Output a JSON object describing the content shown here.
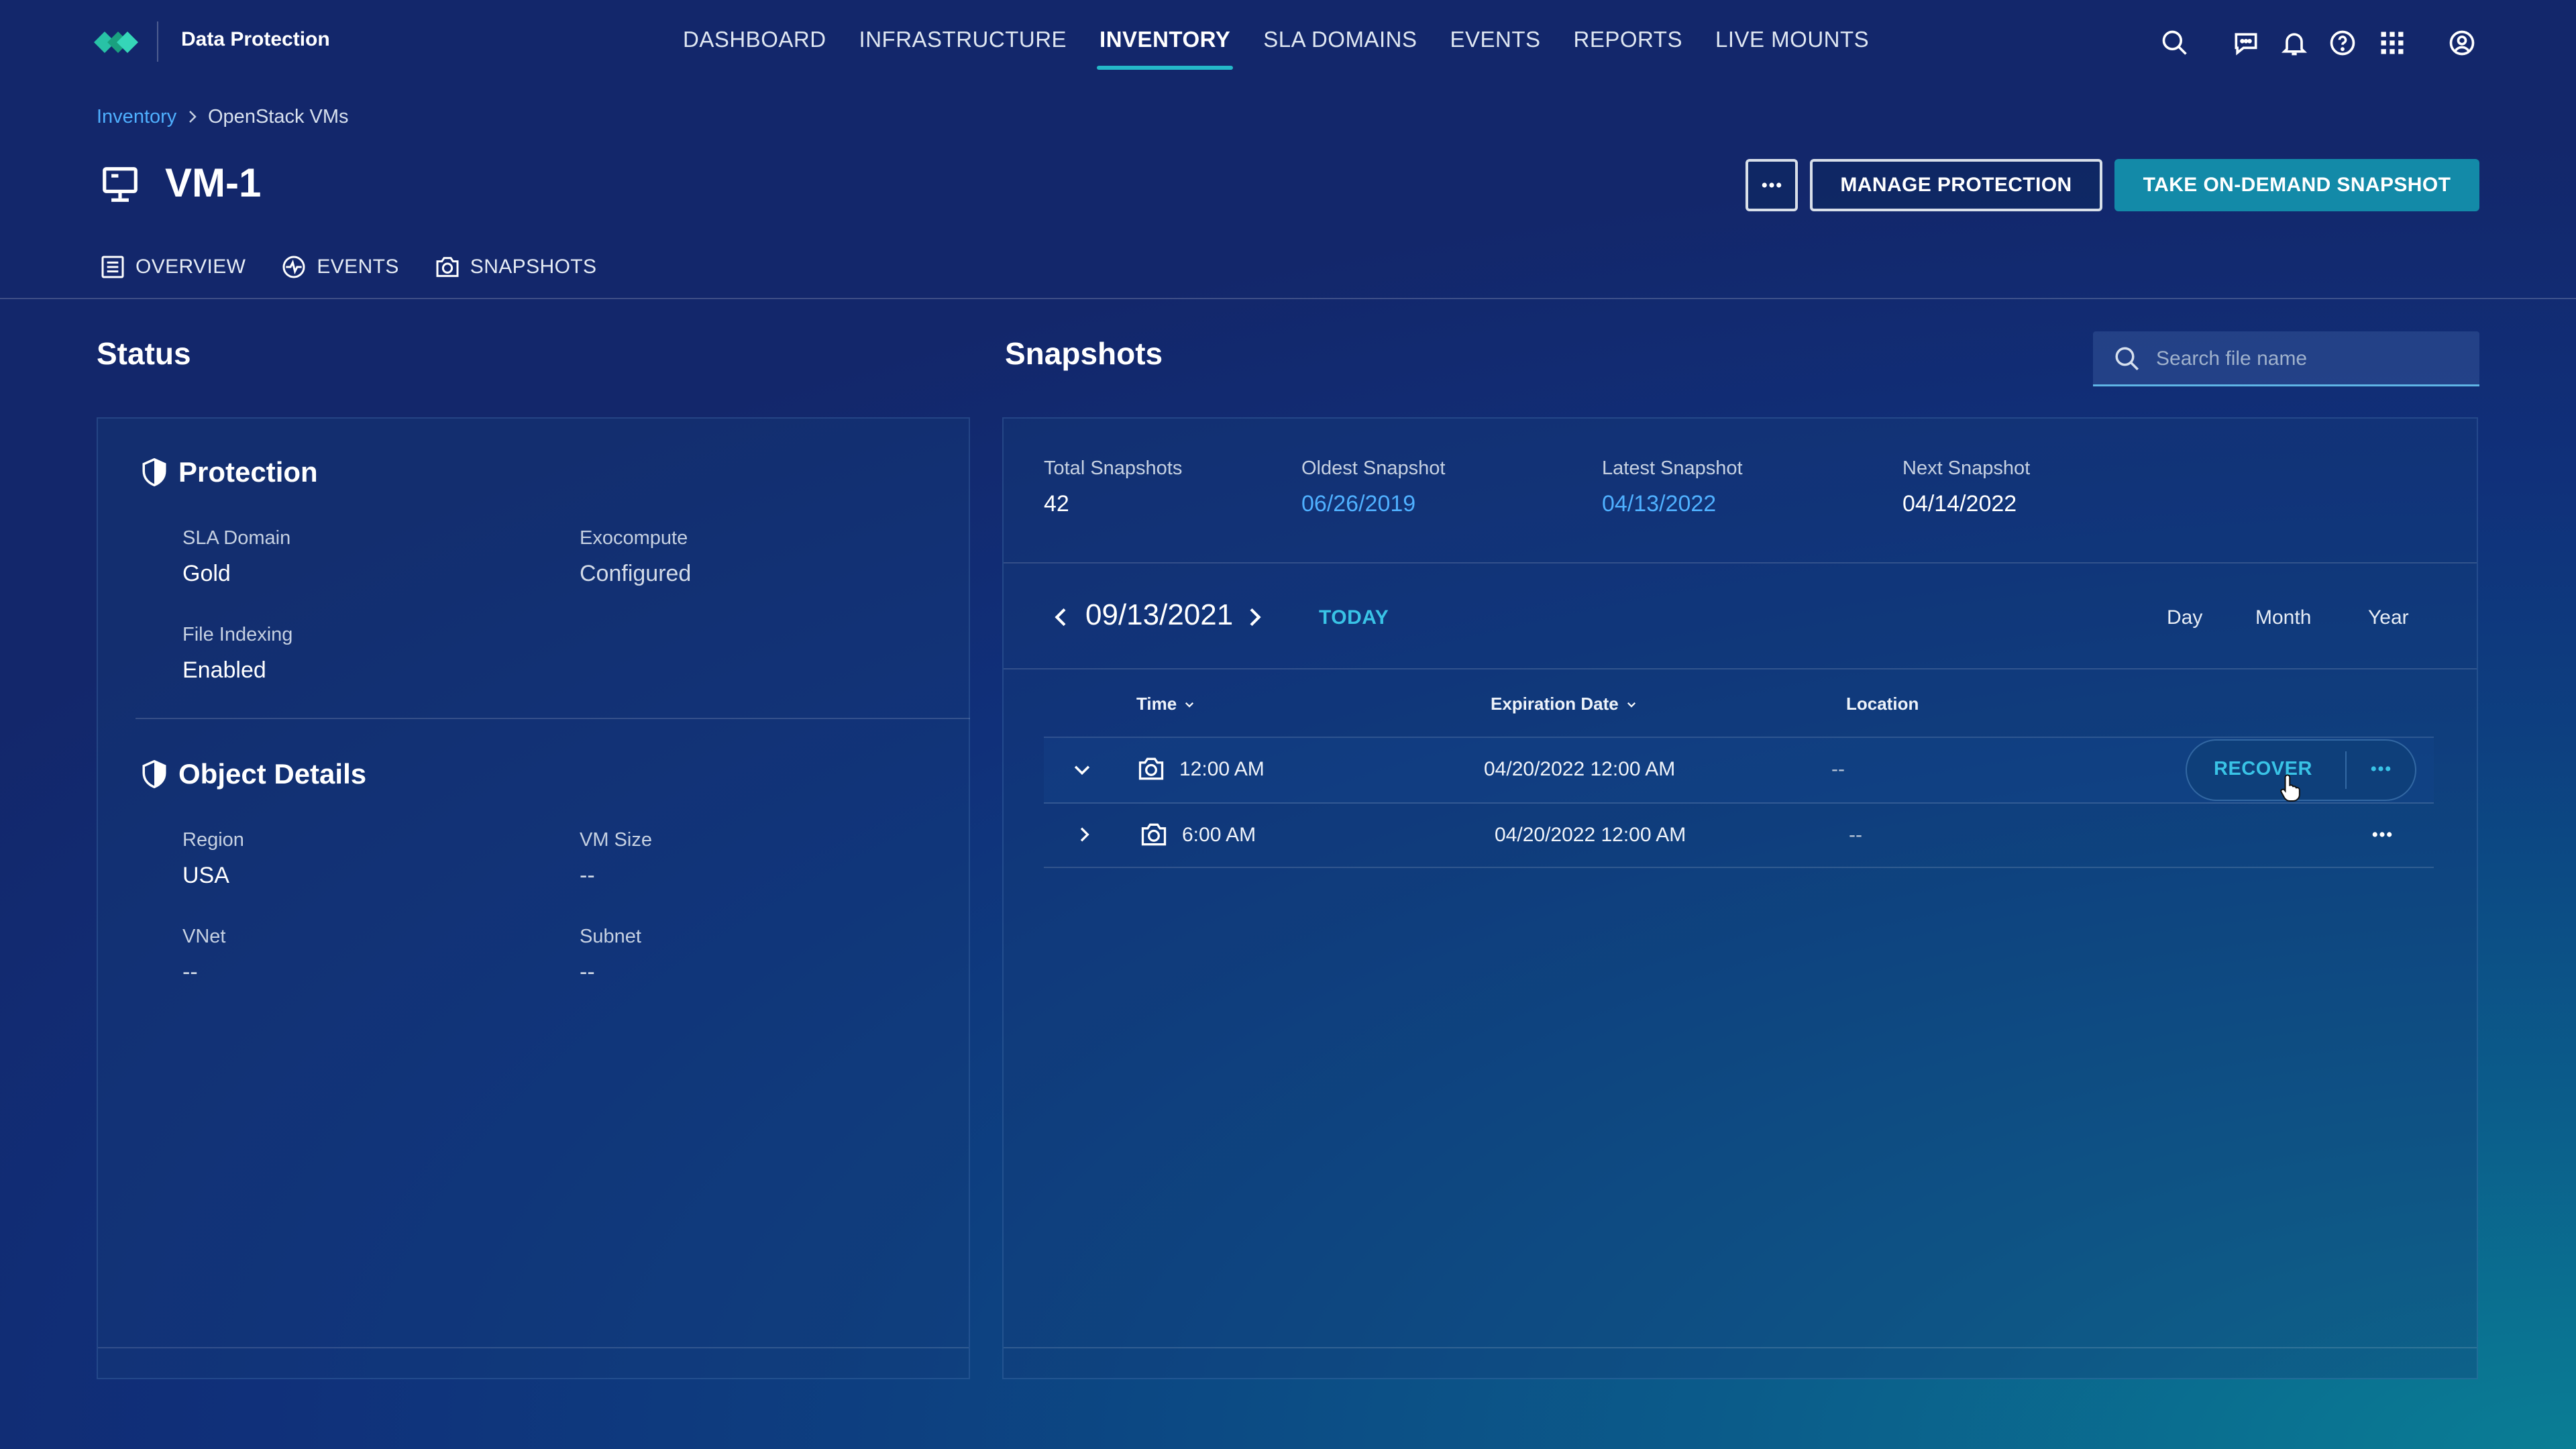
{
  "app": {
    "brand": "Data Protection"
  },
  "nav": {
    "items": [
      {
        "label": "DASHBOARD",
        "active": false
      },
      {
        "label": "INFRASTRUCTURE",
        "active": false
      },
      {
        "label": "INVENTORY",
        "active": true
      },
      {
        "label": "SLA DOMAINS",
        "active": false
      },
      {
        "label": "EVENTS",
        "active": false
      },
      {
        "label": "REPORTS",
        "active": false
      },
      {
        "label": "LIVE MOUNTS",
        "active": false
      }
    ],
    "icons": [
      "search-icon",
      "chat-icon",
      "bell-icon",
      "help-icon",
      "apps-grid-icon",
      "user-account-icon"
    ]
  },
  "breadcrumb": {
    "parent": "Inventory",
    "current": "OpenStack VMs"
  },
  "page": {
    "title": "VM-1",
    "buttons": {
      "more": "more-options",
      "manage": "MANAGE PROTECTION",
      "snapshot": "TAKE ON-DEMAND SNAPSHOT"
    }
  },
  "tabs": [
    {
      "label": "OVERVIEW",
      "icon": "list-icon"
    },
    {
      "label": "EVENTS",
      "icon": "activity-icon"
    },
    {
      "label": "SNAPSHOTS",
      "icon": "camera-icon"
    }
  ],
  "status": {
    "heading": "Status",
    "protection": {
      "heading": "Protection",
      "sla_label": "SLA Domain",
      "sla_value": "Gold",
      "exo_label": "Exocompute",
      "exo_value": "Configured",
      "idx_label": "File Indexing",
      "idx_value": "Enabled"
    },
    "object": {
      "heading": "Object Details",
      "region_label": "Region",
      "region_value": "USA",
      "size_label": "VM Size",
      "size_value": "--",
      "vnet_label": "VNet",
      "vnet_value": "--",
      "subnet_label": "Subnet",
      "subnet_value": "--"
    }
  },
  "snapshots": {
    "heading": "Snapshots",
    "search_placeholder": "Search file name",
    "summary": {
      "total_label": "Total Snapshots",
      "total_value": "42",
      "oldest_label": "Oldest Snapshot",
      "oldest_value": "06/26/2019",
      "latest_label": "Latest Snapshot",
      "latest_value": "04/13/2022",
      "next_label": "Next Snapshot",
      "next_value": "04/14/2022"
    },
    "calendar": {
      "date": "09/13/2021",
      "today": "TODAY",
      "views": [
        "Day",
        "Month",
        "Year"
      ]
    },
    "table": {
      "headers": {
        "time": "Time",
        "expiration": "Expiration Date",
        "location": "Location"
      },
      "rows": [
        {
          "time": "12:00 AM",
          "expiration": "04/20/2022 12:00 AM",
          "location": "--",
          "expanded": true
        },
        {
          "time": "6:00 AM",
          "expiration": "04/20/2022 12:00 AM",
          "location": "--",
          "expanded": false
        }
      ],
      "recover_label": "RECOVER"
    }
  },
  "colors": {
    "accent": "#24b8c8",
    "link": "#4fb0ff",
    "primary_button": "#138aa8"
  }
}
